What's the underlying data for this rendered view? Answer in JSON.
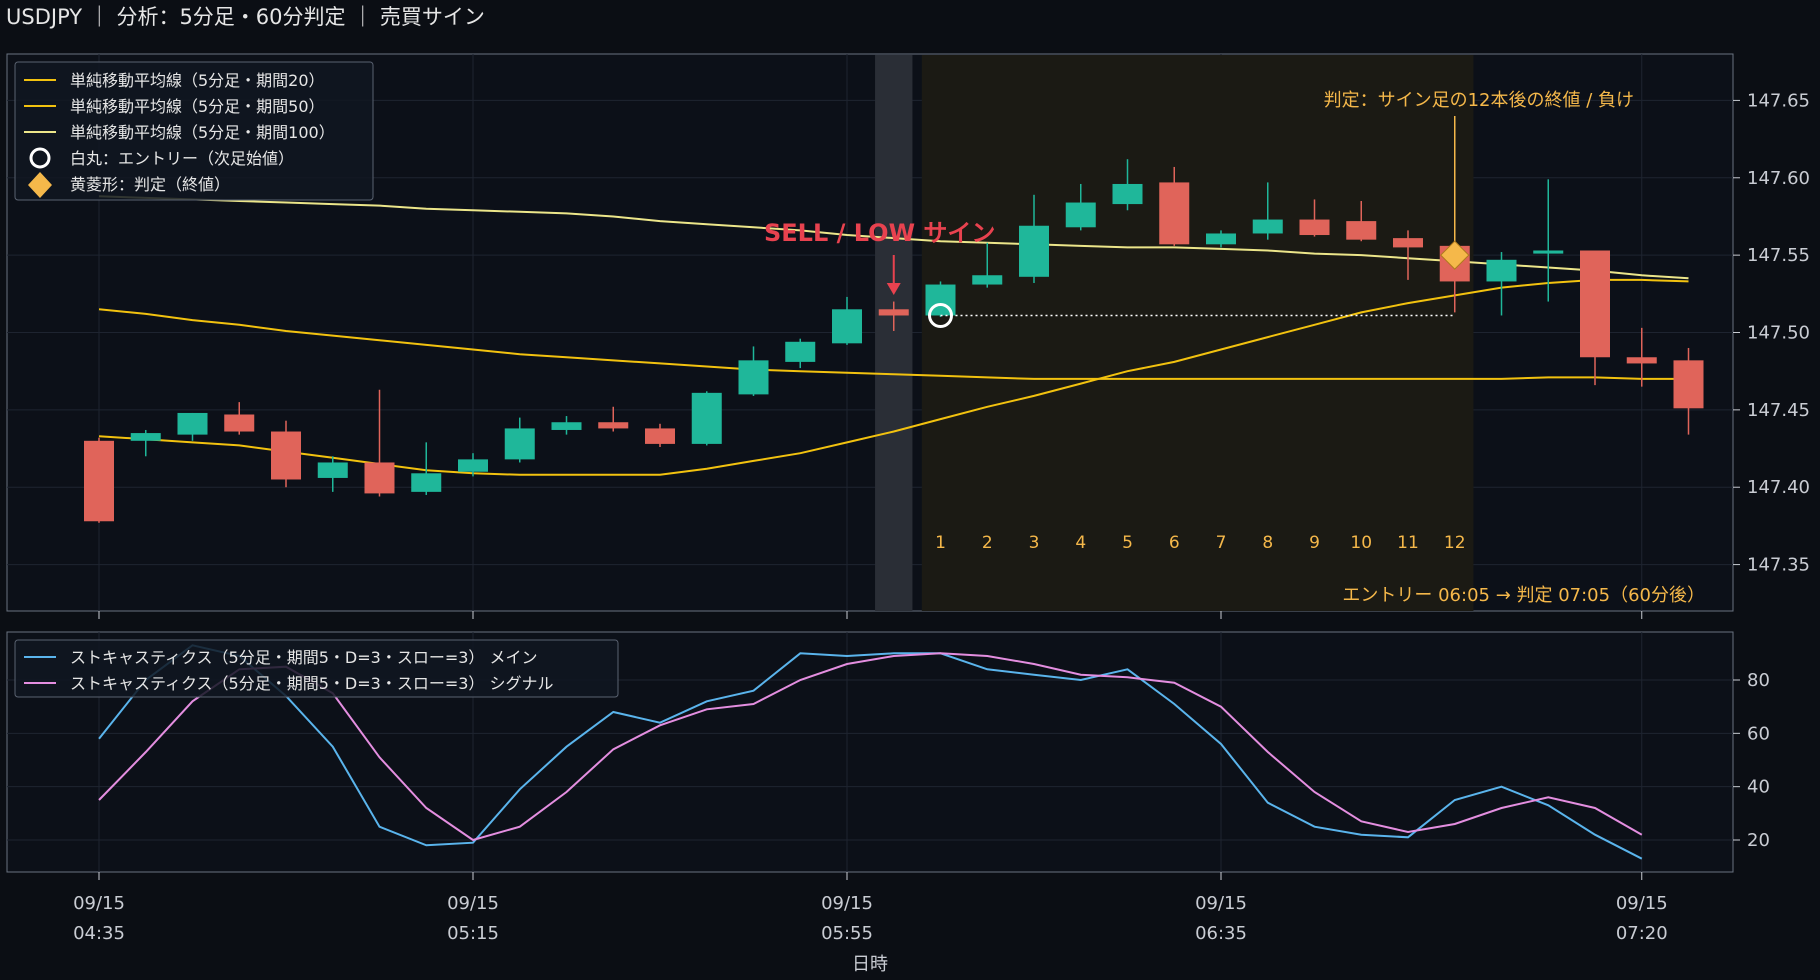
{
  "title": "USDJPY ｜ 分析：5分足・60分判定 ｜ 売買サイン",
  "colors": {
    "background": "#0b0e14",
    "up": "#1fb79a",
    "down": "#e0645a",
    "sma": "#f2c20f",
    "sma100": "#ece68a",
    "sell": "#e8424f",
    "annotation": "#f5b84a",
    "stoch_main": "#5ab4ec",
    "stoch_signal": "#e48ee0"
  },
  "annotations": {
    "sell_label": "SELL / LOW サイン",
    "judgment_label": "判定：サイン足の12本後の終値 / 負け",
    "entry_summary": "エントリー 06:05 → 判定 07:05（60分後）",
    "count_labels": [
      "1",
      "2",
      "3",
      "4",
      "5",
      "6",
      "7",
      "8",
      "9",
      "10",
      "11",
      "12"
    ]
  },
  "legend_main": [
    {
      "label": "単純移動平均線（5分足・期間20）",
      "icon": "line-icon"
    },
    {
      "label": "単純移動平均線（5分足・期間50）",
      "icon": "line-icon"
    },
    {
      "label": "単純移動平均線（5分足・期間100）",
      "icon": "line-icon"
    },
    {
      "label": "白丸：エントリー（次足始値）",
      "icon": "circle-icon"
    },
    {
      "label": "黄菱形：判定（終値）",
      "icon": "diamond-icon"
    }
  ],
  "legend_stoch": [
    {
      "label": "ストキャスティクス（5分足・期間5・D=3・スロー=3） メイン"
    },
    {
      "label": "ストキャスティクス（5分足・期間5・D=3・スロー=3） シグナル"
    }
  ],
  "chart_data": [
    {
      "type": "candlestick",
      "instrument": "USDJPY",
      "timeframe": "5分足",
      "x_ticks": [
        {
          "index": 0,
          "line1": "09/15",
          "line2": "04:35"
        },
        {
          "index": 8,
          "line1": "09/15",
          "line2": "05:15"
        },
        {
          "index": 16,
          "line1": "09/15",
          "line2": "05:55"
        },
        {
          "index": 24,
          "line1": "09/15",
          "line2": "06:35"
        },
        {
          "index": 33,
          "line1": "09/15",
          "line2": "07:20"
        }
      ],
      "xlabel": "日時",
      "y_ticks": [
        147.35,
        147.4,
        147.45,
        147.5,
        147.55,
        147.6,
        147.65
      ],
      "ylim": [
        147.32,
        147.68
      ],
      "ohlc": [
        [
          147.43,
          147.432,
          147.377,
          147.378
        ],
        [
          147.43,
          147.437,
          147.42,
          147.435
        ],
        [
          147.434,
          147.448,
          147.43,
          147.448
        ],
        [
          147.447,
          147.455,
          147.434,
          147.436
        ],
        [
          147.436,
          147.443,
          147.4,
          147.405
        ],
        [
          147.406,
          147.42,
          147.397,
          147.416
        ],
        [
          147.416,
          147.463,
          147.394,
          147.396
        ],
        [
          147.397,
          147.429,
          147.395,
          147.409
        ],
        [
          147.41,
          147.422,
          147.407,
          147.418
        ],
        [
          147.418,
          147.445,
          147.416,
          147.438
        ],
        [
          147.437,
          147.446,
          147.434,
          147.442
        ],
        [
          147.442,
          147.452,
          147.436,
          147.438
        ],
        [
          147.438,
          147.441,
          147.426,
          147.428
        ],
        [
          147.428,
          147.462,
          147.427,
          147.461
        ],
        [
          147.46,
          147.491,
          147.459,
          147.482
        ],
        [
          147.481,
          147.496,
          147.477,
          147.494
        ],
        [
          147.493,
          147.523,
          147.492,
          147.515
        ],
        [
          147.515,
          147.52,
          147.501,
          147.511
        ],
        [
          147.511,
          147.533,
          147.51,
          147.531
        ],
        [
          147.531,
          147.558,
          147.529,
          147.537
        ],
        [
          147.536,
          147.589,
          147.532,
          147.569
        ],
        [
          147.568,
          147.596,
          147.566,
          147.584
        ],
        [
          147.583,
          147.612,
          147.579,
          147.596
        ],
        [
          147.597,
          147.607,
          147.556,
          147.557
        ],
        [
          147.557,
          147.566,
          147.555,
          147.564
        ],
        [
          147.564,
          147.597,
          147.56,
          147.573
        ],
        [
          147.573,
          147.586,
          147.562,
          147.563
        ],
        [
          147.572,
          147.585,
          147.559,
          147.56
        ],
        [
          147.561,
          147.566,
          147.534,
          147.555
        ],
        [
          147.556,
          147.556,
          147.513,
          147.533
        ],
        [
          147.533,
          147.552,
          147.511,
          147.547
        ],
        [
          147.551,
          147.599,
          147.52,
          147.553
        ],
        [
          147.553,
          147.553,
          147.466,
          147.484
        ],
        [
          147.484,
          147.503,
          147.465,
          147.48
        ],
        [
          147.482,
          147.49,
          147.434,
          147.451
        ]
      ],
      "series": [
        {
          "name": "単純移動平均線（5分足・期間20）",
          "values": [
            147.433,
            147.431,
            147.429,
            147.427,
            147.423,
            147.419,
            147.415,
            147.411,
            147.409,
            147.408,
            147.408,
            147.408,
            147.408,
            147.412,
            147.417,
            147.422,
            147.429,
            147.436,
            147.444,
            147.452,
            147.459,
            147.467,
            147.475,
            147.481,
            147.489,
            147.497,
            147.505,
            147.513,
            147.519,
            147.524,
            147.529,
            147.532,
            147.534,
            147.534,
            147.533
          ]
        },
        {
          "name": "単純移動平均線（5分足・期間50）",
          "values": [
            147.515,
            147.512,
            147.508,
            147.505,
            147.501,
            147.498,
            147.495,
            147.492,
            147.489,
            147.486,
            147.484,
            147.482,
            147.48,
            147.478,
            147.476,
            147.475,
            147.474,
            147.473,
            147.472,
            147.471,
            147.47,
            147.47,
            147.47,
            147.47,
            147.47,
            147.47,
            147.47,
            147.47,
            147.47,
            147.47,
            147.47,
            147.471,
            147.471,
            147.47,
            147.47
          ]
        },
        {
          "name": "単純移動平均線（5分足・期間100）",
          "values": [
            147.588,
            147.587,
            147.586,
            147.585,
            147.584,
            147.583,
            147.582,
            147.58,
            147.579,
            147.578,
            147.577,
            147.575,
            147.572,
            147.57,
            147.568,
            147.566,
            147.563,
            147.561,
            147.559,
            147.558,
            147.557,
            147.556,
            147.555,
            147.555,
            147.554,
            147.553,
            147.551,
            147.55,
            147.548,
            147.546,
            147.544,
            147.542,
            147.54,
            147.537,
            147.535
          ]
        }
      ],
      "signal": {
        "index": 17,
        "direction": "SELL / LOW",
        "value": 147.511
      },
      "entry": {
        "index": 18,
        "price": 147.511
      },
      "judgment": {
        "index": 29,
        "price": 147.55,
        "result": "負け"
      }
    },
    {
      "type": "line",
      "name": "ストキャスティクス",
      "y_ticks": [
        20,
        40,
        60,
        80
      ],
      "ylim": [
        8,
        98
      ],
      "series": [
        {
          "name": "ストキャスティクス（5分足・期間5・D=3・スロー=3） メイン",
          "values": [
            58,
            80,
            93,
            89,
            74,
            55,
            25,
            18,
            19,
            39,
            55,
            68,
            64,
            72,
            76,
            90,
            89,
            90,
            90,
            84,
            82,
            80,
            84,
            71,
            56,
            34,
            25,
            22,
            21,
            35,
            40,
            33,
            22,
            13
          ]
        },
        {
          "name": "ストキャスティクス（5分足・期間5・D=3・スロー=3） シグナル",
          "values": [
            35,
            53,
            72,
            84,
            85,
            75,
            51,
            32,
            20,
            25,
            38,
            54,
            63,
            69,
            71,
            80,
            86,
            89,
            90,
            89,
            86,
            82,
            81,
            79,
            70,
            53,
            38,
            27,
            23,
            26,
            32,
            36,
            32,
            22
          ]
        }
      ]
    }
  ]
}
